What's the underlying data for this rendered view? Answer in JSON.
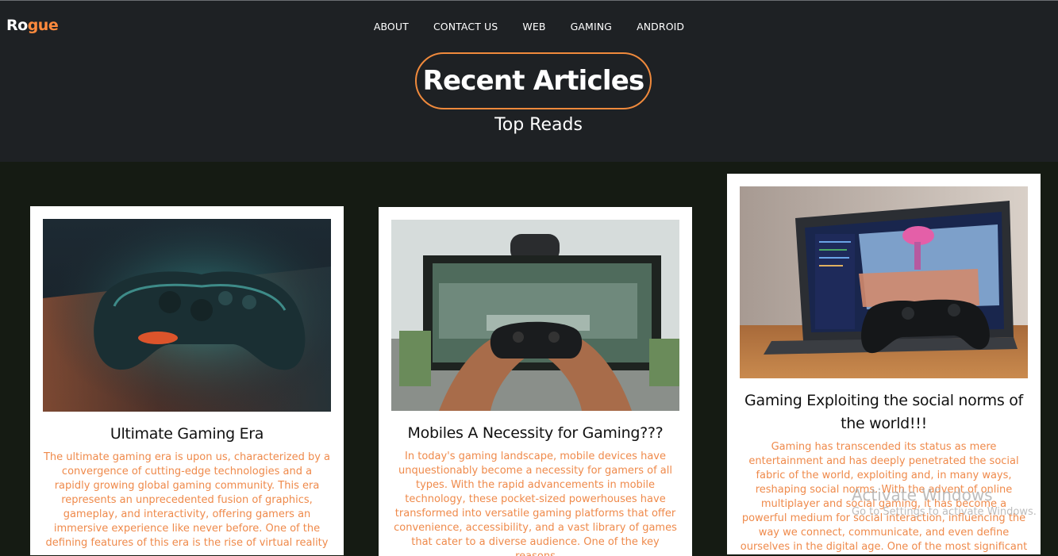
{
  "brand": {
    "part1": "Ro",
    "part2": "gue"
  },
  "nav": [
    "ABOUT",
    "CONTACT US",
    "WEB",
    "GAMING",
    "ANDROID"
  ],
  "hero": {
    "title": "Recent Articles",
    "subtitle": "Top Reads"
  },
  "colors": {
    "accent": "#ff8a3d",
    "header_bg": "#1e2124",
    "page_bg": "#151b13",
    "body_text": "#ef8a4b"
  },
  "articles": [
    {
      "image": "gamepad-on-table-photo",
      "title": "Ultimate Gaming Era",
      "body": "The ultimate gaming era is upon us, characterized by a convergence of cutting-edge technologies and a rapidly growing global gaming community. This era represents an unprecedented fusion of graphics, gameplay, and interactivity, offering gamers an immersive experience like never before. One of the defining features of this era is the rise of virtual reality"
    },
    {
      "image": "hands-holding-controller-photo",
      "title": "Mobiles A Necessity for Gaming???",
      "body": "In today's gaming landscape, mobile devices have unquestionably become a necessity for gamers of all types. With the rapid advancements in mobile technology, these pocket-sized powerhouses have transformed into versatile gaming platforms that offer convenience, accessibility, and a vast library of games that cater to a diverse audience. One of the key reasons"
    },
    {
      "image": "laptop-and-controller-photo",
      "title": "Gaming Exploiting the social norms of the world!!!",
      "body": "Gaming has transcended its status as mere entertainment and has deeply penetrated the social fabric of the world, exploiting and, in many ways, reshaping social norms. With the advent of online multiplayer and social gaming, it has become a powerful medium for social interaction, influencing the way we connect, communicate, and even define ourselves in the digital age. One of the most significant"
    }
  ],
  "os_watermark": {
    "line1": "Activate Windows",
    "line2": "Go to Settings to activate Windows."
  }
}
